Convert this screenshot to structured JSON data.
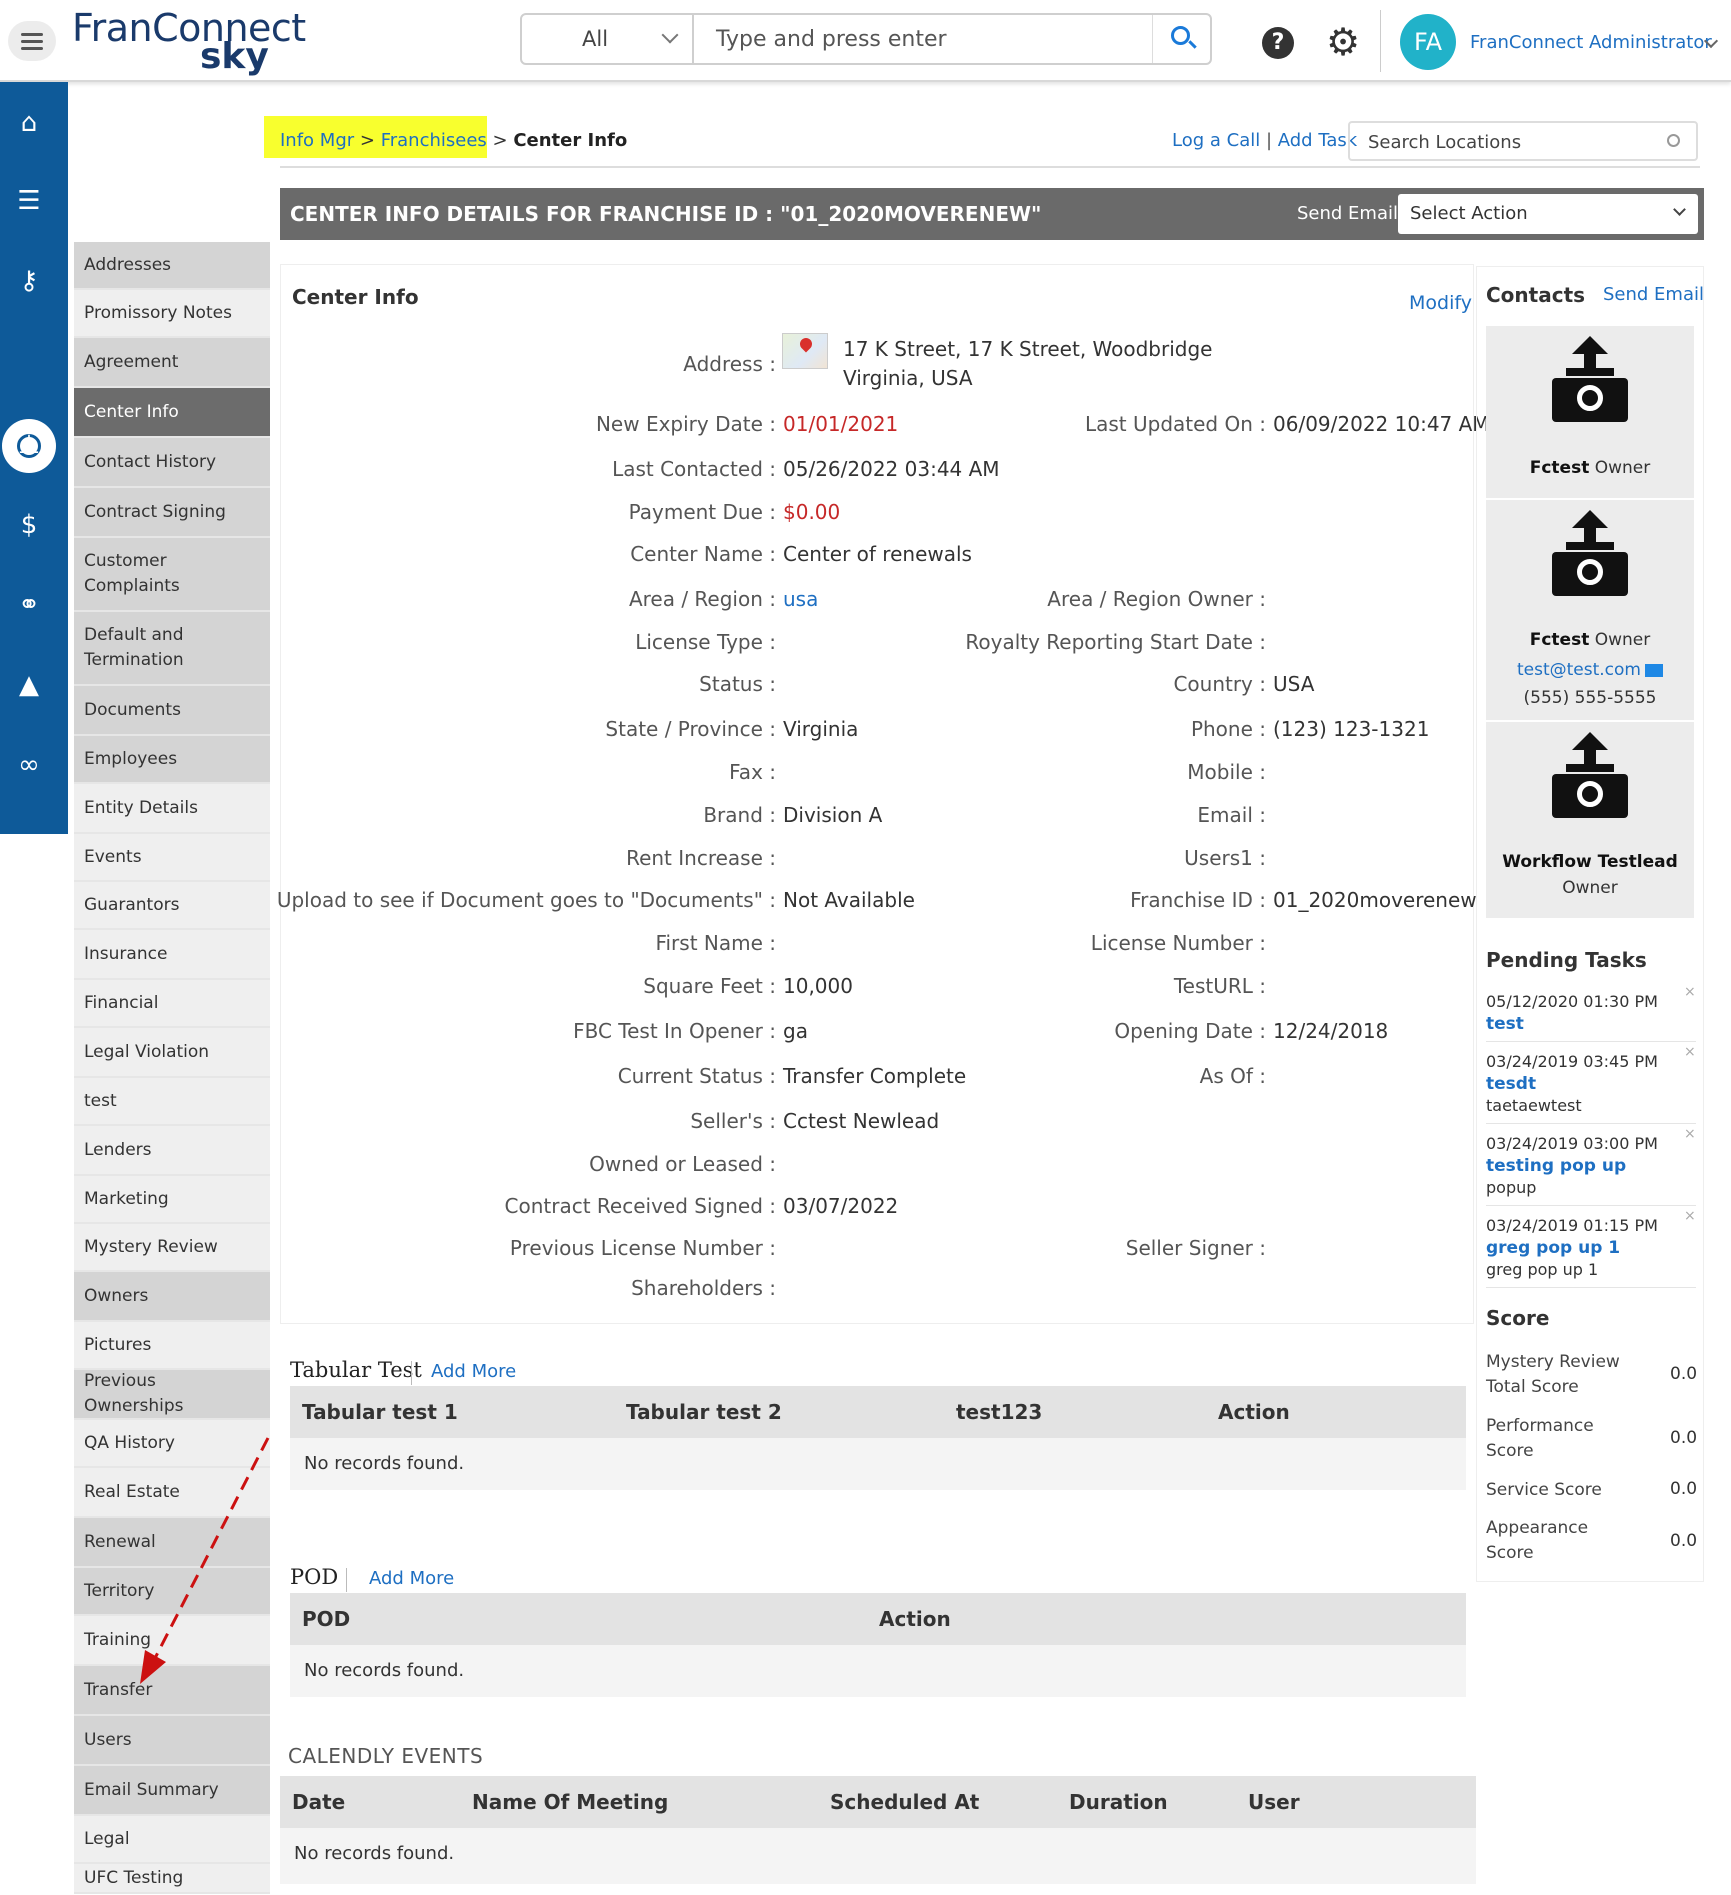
{
  "header": {
    "logo_top": "FranConnect",
    "logo_bottom": "sky",
    "search_scope": "All",
    "search_placeholder": "Type and press enter",
    "user_initials": "FA",
    "user_name": "FranConnect Administrator"
  },
  "breadcrumb": {
    "item1": "Info Mgr",
    "sep1": " > ",
    "item2": "Franchisees",
    "sep2": " > ",
    "current": "Center Info"
  },
  "top_links": {
    "log_call": "Log a Call",
    "sep": " | ",
    "add_task": "Add Task",
    "search_locations": "Search Locations"
  },
  "title_bar": {
    "title": "CENTER INFO DETAILS FOR FRANCHISE ID : \"01_2020MOVERENEW\"",
    "send_email": "Send Email",
    "select_action": "Select Action"
  },
  "sidenav": [
    {
      "label": "Addresses",
      "style": "gray"
    },
    {
      "label": "Promissory Notes",
      "style": "white"
    },
    {
      "label": "Agreement",
      "style": "gray"
    },
    {
      "label": "Center Info",
      "style": "active"
    },
    {
      "label": "Contact History",
      "style": "gray"
    },
    {
      "label": "Contract Signing",
      "style": "gray"
    },
    {
      "label": "Customer Complaints",
      "style": "gray"
    },
    {
      "label": "Default and Termination",
      "style": "gray"
    },
    {
      "label": "Documents",
      "style": "gray"
    },
    {
      "label": "Employees",
      "style": "gray"
    },
    {
      "label": "Entity Details",
      "style": "white"
    },
    {
      "label": "Events",
      "style": "white"
    },
    {
      "label": "Guarantors",
      "style": "white"
    },
    {
      "label": "Insurance",
      "style": "white"
    },
    {
      "label": "Financial",
      "style": "white"
    },
    {
      "label": "Legal Violation",
      "style": "white"
    },
    {
      "label": "test",
      "style": "white"
    },
    {
      "label": "Lenders",
      "style": "white"
    },
    {
      "label": "Marketing",
      "style": "white"
    },
    {
      "label": "Mystery Review",
      "style": "white"
    },
    {
      "label": "Owners",
      "style": "gray"
    },
    {
      "label": "Pictures",
      "style": "white"
    },
    {
      "label": "Previous Ownerships",
      "style": "gray"
    },
    {
      "label": "QA History",
      "style": "white"
    },
    {
      "label": "Real Estate",
      "style": "white"
    },
    {
      "label": "Renewal",
      "style": "gray"
    },
    {
      "label": "Territory",
      "style": "gray"
    },
    {
      "label": "Training",
      "style": "white"
    },
    {
      "label": "Transfer",
      "style": "gray"
    },
    {
      "label": "Users",
      "style": "gray"
    },
    {
      "label": "Email Summary",
      "style": "gray"
    },
    {
      "label": "Legal",
      "style": "white"
    },
    {
      "label": "UFC Testing",
      "style": "white"
    }
  ],
  "center_info": {
    "title": "Center Info",
    "modify": "Modify",
    "address_label": "Address :",
    "address_line1": "17 K Street, 17 K Street, Woodbridge",
    "address_line2": "Virginia, USA",
    "fields_left": [
      {
        "label": "New Expiry Date :",
        "value": "01/01/2021",
        "tone": "red"
      },
      {
        "label": "Last Contacted :",
        "value": "05/26/2022 03:44 AM",
        "tone": ""
      },
      {
        "label": "Payment Due :",
        "value": "$0.00",
        "tone": "red"
      },
      {
        "label": "Center Name :",
        "value": "Center of renewals",
        "tone": ""
      },
      {
        "label": "Area / Region :",
        "value": "usa",
        "tone": "link"
      },
      {
        "label": "License Type :",
        "value": "",
        "tone": ""
      },
      {
        "label": "Status :",
        "value": "",
        "tone": ""
      },
      {
        "label": "State / Province :",
        "value": "Virginia",
        "tone": ""
      },
      {
        "label": "Fax :",
        "value": "",
        "tone": ""
      },
      {
        "label": "Brand :",
        "value": "Division A",
        "tone": ""
      },
      {
        "label": "Rent Increase :",
        "value": "",
        "tone": ""
      },
      {
        "label": "Upload to see if Document goes to \"Documents\" :",
        "value": "Not Available",
        "tone": ""
      },
      {
        "label": "First Name :",
        "value": "",
        "tone": ""
      },
      {
        "label": "Square Feet :",
        "value": "10,000",
        "tone": ""
      },
      {
        "label": "FBC Test In Opener :",
        "value": "ga",
        "tone": ""
      },
      {
        "label": "Current Status :",
        "value": "Transfer Complete",
        "tone": ""
      },
      {
        "label": "Seller's :",
        "value": "Cctest Newlead",
        "tone": ""
      },
      {
        "label": "Owned or Leased :",
        "value": "",
        "tone": ""
      },
      {
        "label": "Contract Received Signed :",
        "value": "03/07/2022",
        "tone": ""
      },
      {
        "label": "Previous License Number :",
        "value": "",
        "tone": ""
      },
      {
        "label": "Shareholders :",
        "value": "",
        "tone": ""
      }
    ],
    "fields_right": [
      {
        "label": "Last Updated On :",
        "value": "06/09/2022 10:47 AM"
      },
      {
        "label": "",
        "value": ""
      },
      {
        "label": "",
        "value": ""
      },
      {
        "label": "",
        "value": ""
      },
      {
        "label": "Area / Region Owner :",
        "value": ""
      },
      {
        "label": "Royalty Reporting Start Date :",
        "value": ""
      },
      {
        "label": "Country :",
        "value": "USA"
      },
      {
        "label": "Phone :",
        "value": "(123) 123-1321"
      },
      {
        "label": "Mobile :",
        "value": ""
      },
      {
        "label": "Email :",
        "value": ""
      },
      {
        "label": "Users1 :",
        "value": ""
      },
      {
        "label": "Franchise ID :",
        "value": "01_2020moverenew"
      },
      {
        "label": "License Number :",
        "value": ""
      },
      {
        "label": "TestURL :",
        "value": ""
      },
      {
        "label": "Opening Date :",
        "value": "12/24/2018"
      },
      {
        "label": "As Of :",
        "value": ""
      },
      {
        "label": "",
        "value": ""
      },
      {
        "label": "",
        "value": ""
      },
      {
        "label": "",
        "value": ""
      },
      {
        "label": "Seller Signer :",
        "value": ""
      },
      {
        "label": "",
        "value": ""
      }
    ]
  },
  "tabular_test": {
    "title": "Tabular Test",
    "add_more": "Add More",
    "columns": [
      "Tabular test 1",
      "Tabular test 2",
      "test123",
      "Action"
    ],
    "empty": "No records found."
  },
  "pod": {
    "title": "POD",
    "add_more": "Add More",
    "columns": [
      "POD",
      "Action"
    ],
    "empty": "No records found."
  },
  "calendly": {
    "title": "CALENDLY EVENTS",
    "columns": [
      "Date",
      "Name Of Meeting",
      "Scheduled At",
      "Duration",
      "User"
    ],
    "empty": "No records found."
  },
  "contacts": {
    "title": "Contacts",
    "send_email": "Send Email",
    "items": [
      {
        "name": "Fctest",
        "role": "Owner",
        "email": "",
        "phone": ""
      },
      {
        "name": "Fctest",
        "role": "Owner",
        "email": "test@test.com",
        "phone": "(555) 555-5555"
      },
      {
        "name": "Workflow Testlead",
        "role": "Owner",
        "email": "",
        "phone": ""
      }
    ]
  },
  "pending_tasks": {
    "title": "Pending Tasks",
    "close": "×",
    "items": [
      {
        "date": "05/12/2020 01:30 PM",
        "title": "test",
        "desc": ""
      },
      {
        "date": "03/24/2019 03:45 PM",
        "title": "tesdt",
        "desc": "taetaewtest"
      },
      {
        "date": "03/24/2019 03:00 PM",
        "title": "testing pop up",
        "desc": "popup"
      },
      {
        "date": "03/24/2019 01:15 PM",
        "title": "greg pop up 1",
        "desc": "greg pop up 1"
      }
    ]
  },
  "score": {
    "title": "Score",
    "items": [
      {
        "label": "Mystery Review Total Score",
        "value": "0.0"
      },
      {
        "label": "Performance Score",
        "value": "0.0"
      },
      {
        "label": "Service Score",
        "value": "0.0"
      },
      {
        "label": "Appearance Score",
        "value": "0.0"
      }
    ]
  },
  "colors": {
    "rail": "#0e5a99",
    "link": "#1e6fc2",
    "accent_red": "#c62828",
    "highlight": "#f8ff2e",
    "annotation_arrow": "#cc1111"
  }
}
